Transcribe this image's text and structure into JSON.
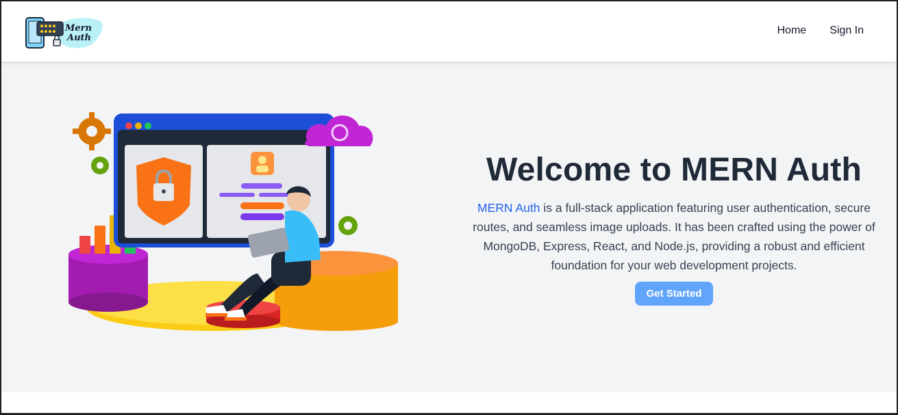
{
  "brand": {
    "logo_line1": "Mern",
    "logo_line2": "Auth"
  },
  "nav": {
    "items": [
      {
        "label": "Home"
      },
      {
        "label": "Sign In"
      }
    ]
  },
  "hero": {
    "title": "Welcome to MERN Auth",
    "desc_accent": "MERN Auth",
    "desc_rest": " is a full-stack application featuring user authentication, secure routes, and seamless image uploads. It has been crafted using the power of MongoDB, Express, React, and Node.js, providing a robust and efficient foundation for your web development projects.",
    "cta_label": "Get Started"
  },
  "colors": {
    "accent_link": "#2563eb",
    "button_bg": "#60a5fa",
    "hero_bg": "#f3f4f6",
    "title": "#1f2937"
  },
  "icons": [
    "app-logo-icon",
    "security-illustration"
  ]
}
